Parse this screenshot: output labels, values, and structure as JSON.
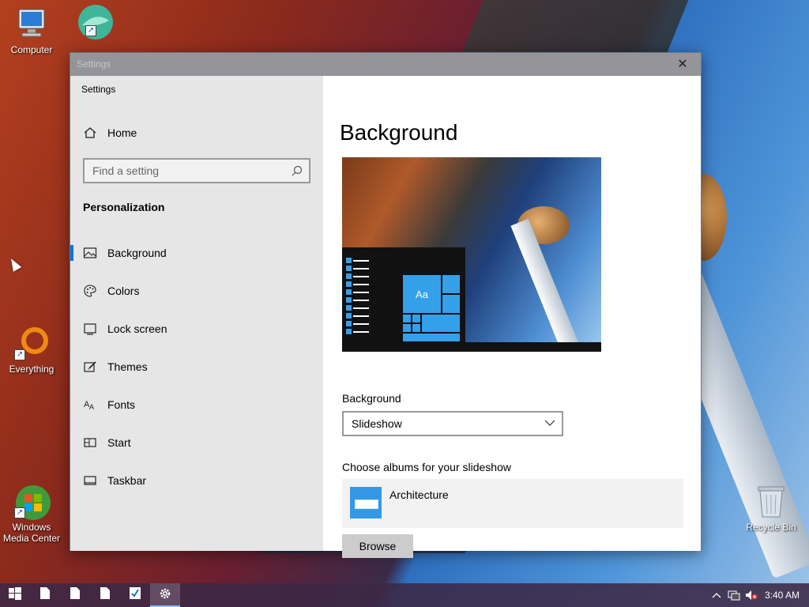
{
  "desktop": {
    "icons": [
      {
        "name": "computer",
        "label": "Computer"
      },
      {
        "name": "everything",
        "label": "Everything"
      },
      {
        "name": "windows-media-center",
        "label": "Windows Media Center"
      },
      {
        "name": "recycle-bin",
        "label": "Recycle Bin"
      }
    ]
  },
  "window": {
    "title": "Settings",
    "close_label": "✕"
  },
  "sidebar": {
    "app_title": "Settings",
    "home_label": "Home",
    "search": {
      "placeholder": "Find a setting"
    },
    "section": "Personalization",
    "items": [
      {
        "label": "Background",
        "icon": "picture-icon",
        "selected": true
      },
      {
        "label": "Colors",
        "icon": "palette-icon",
        "selected": false
      },
      {
        "label": "Lock screen",
        "icon": "lock-screen-icon",
        "selected": false
      },
      {
        "label": "Themes",
        "icon": "brush-icon",
        "selected": false
      },
      {
        "label": "Fonts",
        "icon": "fonts-icon",
        "selected": false
      },
      {
        "label": "Start",
        "icon": "start-icon",
        "selected": false
      },
      {
        "label": "Taskbar",
        "icon": "taskbar-icon",
        "selected": false
      }
    ]
  },
  "main": {
    "heading": "Background",
    "preview_tile_text": "Aa",
    "background_label": "Background",
    "background_value": "Slideshow",
    "albums_label": "Choose albums for your slideshow",
    "album_name": "Architecture",
    "browse_label": "Browse"
  },
  "taskbar": {
    "clock": "3:40 AM"
  },
  "colors": {
    "accent": "#0078d7",
    "tile_blue": "#35a0ea",
    "sidebar_bg": "#e6e6e6"
  }
}
